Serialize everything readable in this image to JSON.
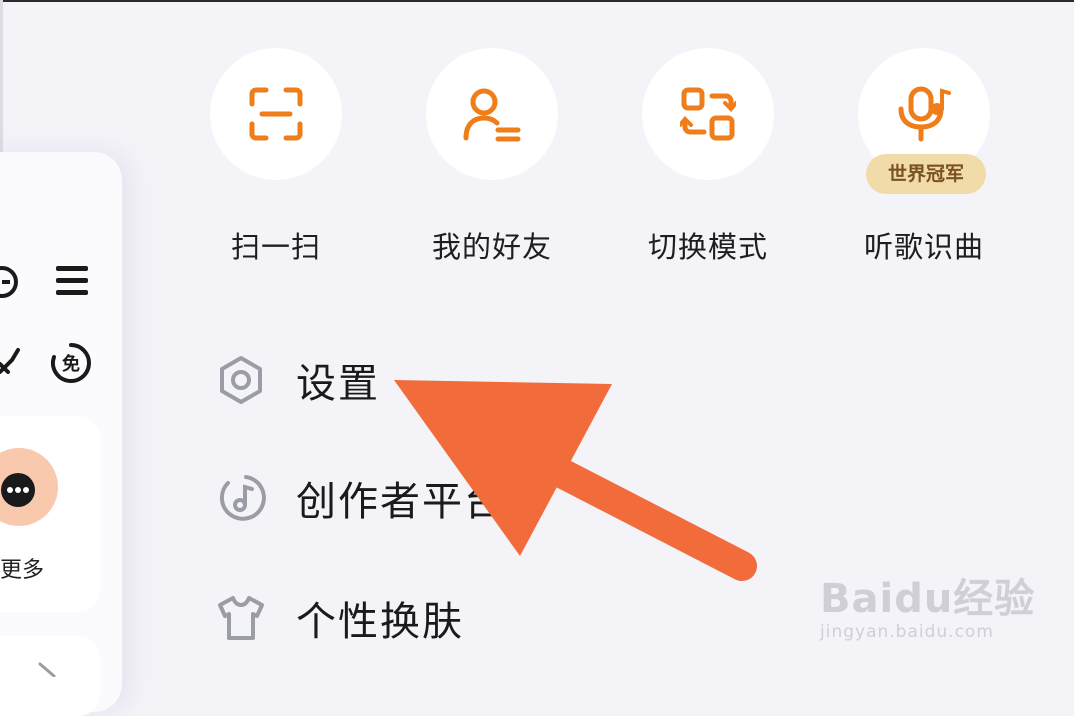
{
  "quick_actions": [
    {
      "label": "扫一扫",
      "icon": "scan-icon"
    },
    {
      "label": "我的好友",
      "icon": "friends-icon"
    },
    {
      "label": "切换模式",
      "icon": "switch-mode-icon"
    },
    {
      "label": "听歌识曲",
      "icon": "music-recognition-icon",
      "badge": "世界冠军"
    }
  ],
  "menu": [
    {
      "label": "设置",
      "icon": "settings-icon"
    },
    {
      "label": "创作者平台",
      "icon": "creator-platform-icon"
    },
    {
      "label": "个性换肤",
      "icon": "skin-icon"
    }
  ],
  "left_panel": {
    "more_label": "更多"
  },
  "watermark": {
    "logo": "Baidu经验",
    "sub": "jingyan.baidu.com"
  },
  "colors": {
    "accent": "#ef7d1a",
    "arrow": "#f26b3a",
    "background": "#f3f3f8",
    "menu_icon": "#9a9ca6"
  }
}
